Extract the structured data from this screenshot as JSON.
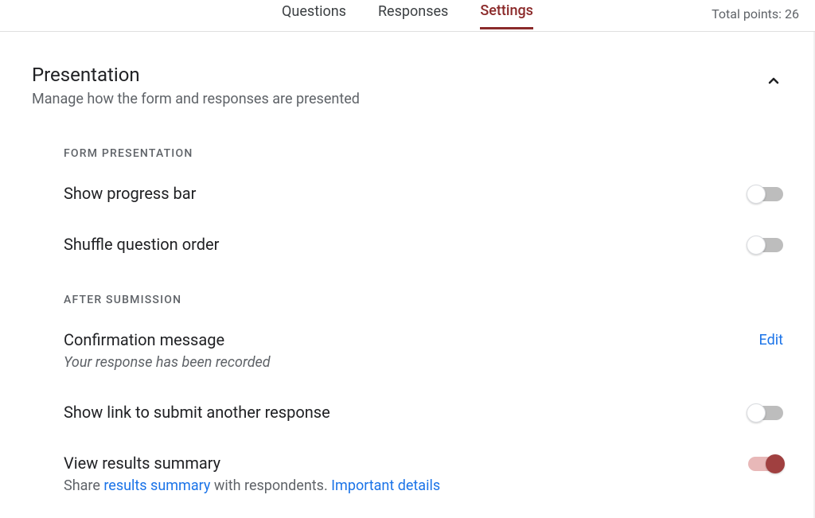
{
  "header": {
    "tabs": {
      "questions": "Questions",
      "responses": "Responses",
      "settings": "Settings"
    },
    "points_label": "Total points: 26"
  },
  "section": {
    "title": "Presentation",
    "subtitle": "Manage how the form and responses are presented"
  },
  "form_presentation": {
    "heading": "FORM PRESENTATION",
    "progress_bar": {
      "label": "Show progress bar",
      "value": false
    },
    "shuffle": {
      "label": "Shuffle question order",
      "value": false
    }
  },
  "after_submission": {
    "heading": "AFTER SUBMISSION",
    "confirmation": {
      "label": "Confirmation message",
      "message": "Your response has been recorded",
      "edit": "Edit"
    },
    "submit_another": {
      "label": "Show link to submit another response",
      "value": false
    },
    "results_summary": {
      "label": "View results summary",
      "desc_prefix": "Share ",
      "desc_link1": "results summary",
      "desc_mid": " with respondents. ",
      "desc_link2": "Important details",
      "value": true
    }
  }
}
